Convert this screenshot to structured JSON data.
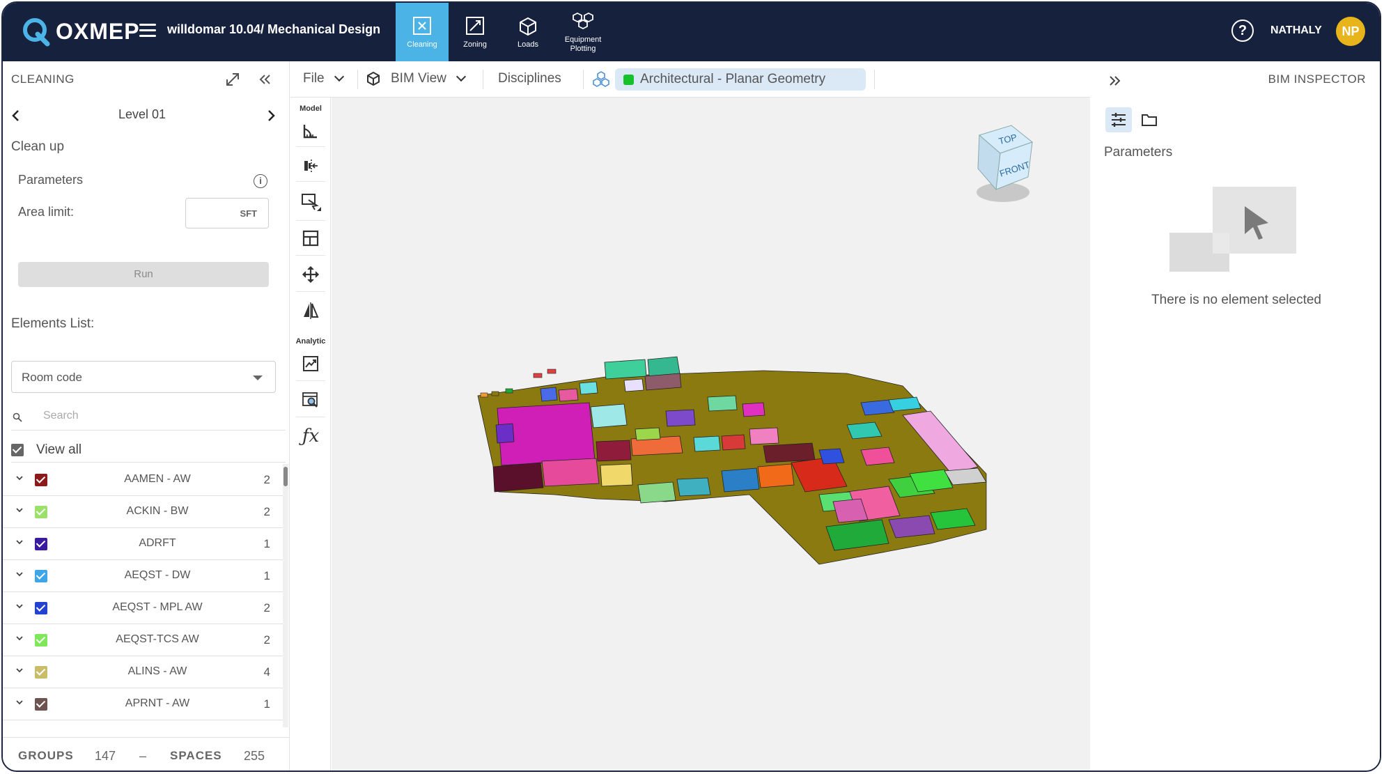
{
  "app": {
    "logo_text": "OXMEP",
    "project_title": "willdomar 10.04/ Mechanical Design",
    "user_name": "NATHALY",
    "user_initials": "NP",
    "help_icon": "question-circle-icon",
    "accent_color": "#4cb3e6",
    "topbar_color": "#16213e",
    "avatar_color": "#e8b41b"
  },
  "modules": [
    {
      "label": "Cleaning",
      "icon": "cleaning-icon",
      "active": true
    },
    {
      "label": "Zoning",
      "icon": "zoning-icon",
      "active": false
    },
    {
      "label": "Loads",
      "icon": "loads-icon",
      "active": false
    },
    {
      "label": "Equipment\nPlotting",
      "label_line1": "Equipment",
      "label_line2": "Plotting",
      "icon": "equipment-plotting-icon",
      "active": false
    }
  ],
  "left_panel": {
    "title": "CLEANING",
    "level": "Level 01",
    "section_title": "Clean up",
    "parameters_label": "Parameters",
    "area_limit_label": "Area limit:",
    "area_unit": "SFT",
    "run_label": "Run",
    "elements_list_label": "Elements List:",
    "group_by_selected": "Room code",
    "search_placeholder": "Search",
    "view_all_label": "View all",
    "items": [
      {
        "name": "AAMEN - AW",
        "count": "2",
        "color": "#8b1a1a"
      },
      {
        "name": "ACKIN - BW",
        "count": "2",
        "color": "#9be06b"
      },
      {
        "name": "ADRFT",
        "count": "1",
        "color": "#3a1a9e"
      },
      {
        "name": "AEQST - DW",
        "count": "1",
        "color": "#3da5e8"
      },
      {
        "name": "AEQST - MPL AW",
        "count": "2",
        "color": "#2342d1"
      },
      {
        "name": "AEQST-TCS AW",
        "count": "2",
        "color": "#7ee85a"
      },
      {
        "name": "ALINS - AW",
        "count": "4",
        "color": "#c9bd6a"
      },
      {
        "name": "APRNT - AW",
        "count": "1",
        "color": "#6e5450"
      }
    ],
    "footer": {
      "groups_label": "GROUPS",
      "groups_count": "147",
      "separator": "–",
      "spaces_label": "SPACES",
      "spaces_count": "255"
    }
  },
  "toolbar": {
    "file_label": "File",
    "bim_view_label": "BIM View",
    "disciplines_label": "Disciplines",
    "active_discipline": "Architectural - Planar Geometry",
    "active_discipline_color": "#17c12b"
  },
  "tool_strip": {
    "model_heading": "Model",
    "analytic_heading": "Analytic",
    "model_tools": [
      "measure-angle-icon",
      "align-icon",
      "section-box-icon",
      "layout-icon",
      "move-icon",
      "mirror-icon"
    ],
    "analytic_tools": [
      "trend-chart-icon",
      "inspect-zoom-icon",
      "formula-icon"
    ]
  },
  "viewcube": {
    "top_label": "TOP",
    "front_label": "FRONT"
  },
  "right_panel": {
    "title": "BIM INSPECTOR",
    "parameters_label": "Parameters",
    "empty_message": "There is no element selected"
  }
}
